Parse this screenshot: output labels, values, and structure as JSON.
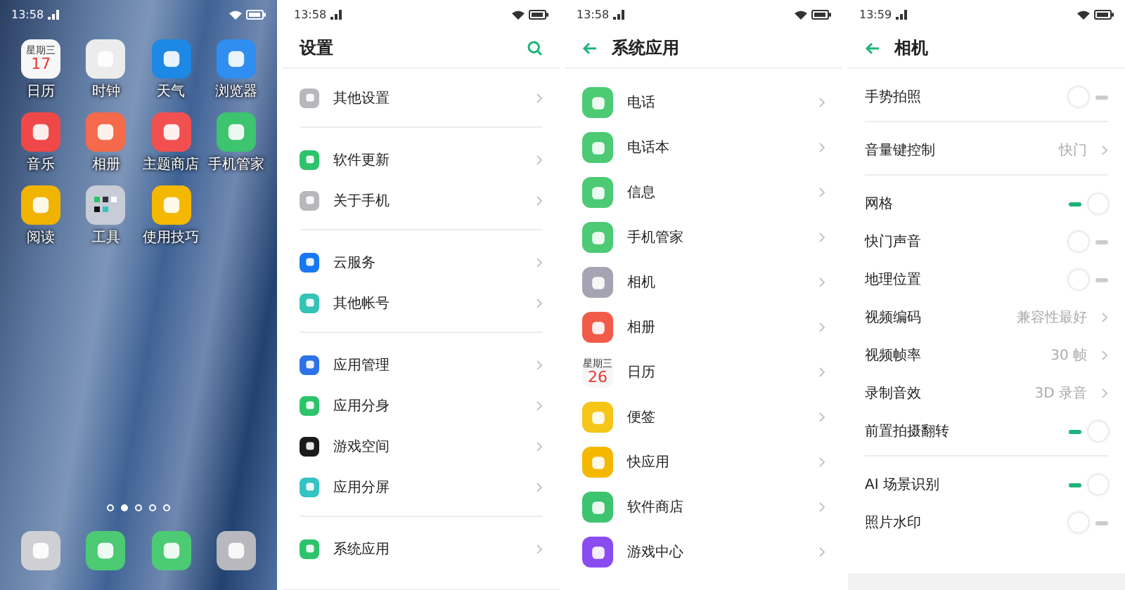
{
  "screens": [
    {
      "kind": "home",
      "status": {
        "time": "13:58"
      },
      "apps": [
        {
          "kind": "calendar",
          "label": "日历",
          "weekday": "星期三",
          "date": "17",
          "color": "#f7f7f7"
        },
        {
          "kind": "app",
          "label": "时钟",
          "color": "#ececec"
        },
        {
          "kind": "app",
          "label": "天气",
          "color": "#1e88e5"
        },
        {
          "kind": "app",
          "label": "浏览器",
          "color": "#2f8ef0"
        },
        {
          "kind": "app",
          "label": "音乐",
          "color": "#f04848"
        },
        {
          "kind": "app",
          "label": "相册",
          "color": "#f46a4a"
        },
        {
          "kind": "app",
          "label": "主题商店",
          "color": "#f25050"
        },
        {
          "kind": "app",
          "label": "手机管家",
          "color": "#3cc46e"
        },
        {
          "kind": "app",
          "label": "阅读",
          "color": "#f0b400"
        },
        {
          "kind": "folder",
          "label": "工具",
          "color": "#c8ccd6"
        },
        {
          "kind": "app",
          "label": "使用技巧",
          "color": "#f5b800"
        }
      ],
      "page_dots": [
        {
          "selected": false
        },
        {
          "selected": true
        },
        {
          "selected": false
        },
        {
          "selected": false
        },
        {
          "selected": false
        }
      ],
      "dock": [
        {
          "color": "#cfcfd4"
        },
        {
          "color": "#4cca74"
        },
        {
          "color": "#4cca74"
        },
        {
          "color": "#b8b8be"
        }
      ]
    },
    {
      "kind": "list",
      "status": {
        "time": "13:58"
      },
      "title": "设置",
      "search": true,
      "back": false,
      "groups": [
        {
          "rows": [
            {
              "kind": "link",
              "label": "其他设置",
              "color": "#b8b8bc"
            }
          ]
        },
        {
          "rows": [
            {
              "kind": "link",
              "label": "软件更新",
              "color": "#2cc36b"
            },
            {
              "kind": "link",
              "label": "关于手机",
              "color": "#b8b8bc"
            }
          ]
        },
        {
          "rows": [
            {
              "kind": "link",
              "label": "云服务",
              "color": "#1877f2"
            },
            {
              "kind": "link",
              "label": "其他帐号",
              "color": "#35c3b5"
            }
          ]
        },
        {
          "rows": [
            {
              "kind": "link",
              "label": "应用管理",
              "color": "#2b73e6"
            },
            {
              "kind": "link",
              "label": "应用分身",
              "color": "#2cc36b"
            },
            {
              "kind": "link",
              "label": "游戏空间",
              "color": "#1a1a1a"
            },
            {
              "kind": "link",
              "label": "应用分屏",
              "color": "#35c3c3"
            }
          ]
        },
        {
          "rows": [
            {
              "kind": "link",
              "label": "系统应用",
              "color": "#2cc36b"
            }
          ]
        }
      ]
    },
    {
      "kind": "list",
      "status": {
        "time": "13:58"
      },
      "title": "系统应用",
      "search": false,
      "back": true,
      "groups": [
        {
          "rows": [
            {
              "kind": "link",
              "label": "电话",
              "color": "#4cca74"
            },
            {
              "kind": "link",
              "label": "电话本",
              "color": "#4cca74"
            },
            {
              "kind": "link",
              "label": "信息",
              "color": "#4cca74"
            },
            {
              "kind": "link",
              "label": "手机管家",
              "color": "#4cca74"
            },
            {
              "kind": "link",
              "label": "相机",
              "color": "#a4a4b2"
            },
            {
              "kind": "link",
              "label": "相册",
              "color": "#f25a4a"
            },
            {
              "kind": "calendar",
              "label": "日历",
              "weekday": "星期三",
              "date": "26",
              "color": "#f7f7f7"
            },
            {
              "kind": "link",
              "label": "便签",
              "color": "#f5c518"
            },
            {
              "kind": "link",
              "label": "快应用",
              "color": "#f5b800"
            },
            {
              "kind": "link",
              "label": "软件商店",
              "color": "#3cc46e"
            },
            {
              "kind": "link",
              "label": "游戏中心",
              "color": "#8a4cf0"
            }
          ]
        }
      ]
    },
    {
      "kind": "settings",
      "status": {
        "time": "13:59"
      },
      "title": "相机",
      "search": false,
      "back": true,
      "groups": [
        {
          "rows": [
            {
              "kind": "toggle",
              "label": "手势拍照",
              "on": false
            }
          ]
        },
        {
          "rows": [
            {
              "kind": "value",
              "label": "音量键控制",
              "value": "快门"
            }
          ]
        },
        {
          "rows": [
            {
              "kind": "toggle",
              "label": "网格",
              "on": true
            },
            {
              "kind": "toggle",
              "label": "快门声音",
              "on": false
            },
            {
              "kind": "toggle",
              "label": "地理位置",
              "on": false
            },
            {
              "kind": "value",
              "label": "视频编码",
              "value": "兼容性最好"
            },
            {
              "kind": "value",
              "label": "视频帧率",
              "value": "30 帧"
            },
            {
              "kind": "value",
              "label": "录制音效",
              "value": "3D 录音"
            },
            {
              "kind": "toggle",
              "label": "前置拍摄翻转",
              "on": true
            }
          ]
        },
        {
          "rows": [
            {
              "kind": "toggle",
              "label": "AI 场景识别",
              "on": true
            },
            {
              "kind": "toggle",
              "label": "照片水印",
              "on": false
            }
          ]
        }
      ]
    }
  ]
}
